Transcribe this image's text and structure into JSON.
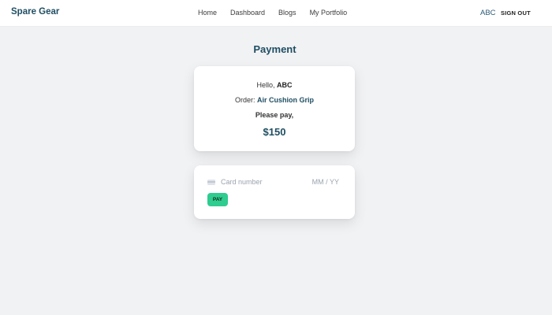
{
  "header": {
    "brand": "Spare Gear",
    "nav": [
      "Home",
      "Dashboard",
      "Blogs",
      "My Portfolio"
    ],
    "user": "ABC",
    "signout": "SIGN OUT"
  },
  "page": {
    "title": "Payment"
  },
  "summary": {
    "greeting_prefix": "Hello, ",
    "user_name": "ABC",
    "order_prefix": "Order: ",
    "order_item": "Air Cushion Grip",
    "pay_prompt": "Please pay,",
    "amount": "$150"
  },
  "payment_form": {
    "card_placeholder": "Card number",
    "expiry_placeholder": "MM / YY",
    "pay_label": "PAY",
    "card_icon": "credit-card-icon"
  },
  "colors": {
    "brand": "#1f4e63",
    "accent": "#2ecc8f",
    "background": "#f1f2f4"
  }
}
